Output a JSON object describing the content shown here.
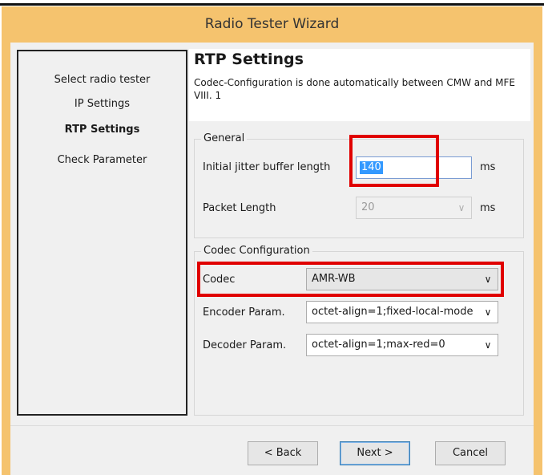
{
  "window": {
    "title": "Radio Tester Wizard"
  },
  "steps": [
    {
      "label": "Select radio tester"
    },
    {
      "label": "IP Settings"
    },
    {
      "label": "RTP Settings",
      "active": true
    },
    {
      "label": "Check Parameter"
    }
  ],
  "header": {
    "title": "RTP Settings",
    "description": "Codec-Configuration is done automatically between CMW and MFE VIII. 1"
  },
  "general": {
    "legend": "General",
    "jitter": {
      "label": "Initial jitter buffer length",
      "value": "140",
      "unit": "ms"
    },
    "packet": {
      "label": "Packet Length",
      "value": "20",
      "unit": "ms"
    }
  },
  "codec_config": {
    "legend": "Codec Configuration",
    "codec": {
      "label": "Codec",
      "value": "AMR-WB"
    },
    "encoder": {
      "label": "Encoder Param.",
      "value": "octet-align=1;fixed-local-mode"
    },
    "decoder": {
      "label": "Decoder Param.",
      "value": "octet-align=1;max-red=0"
    }
  },
  "buttons": {
    "back": "< Back",
    "next": "Next >",
    "cancel": "Cancel"
  },
  "colors": {
    "window_frame": "#f5c36e",
    "highlight": "#e00000",
    "selection": "#3399ff"
  }
}
